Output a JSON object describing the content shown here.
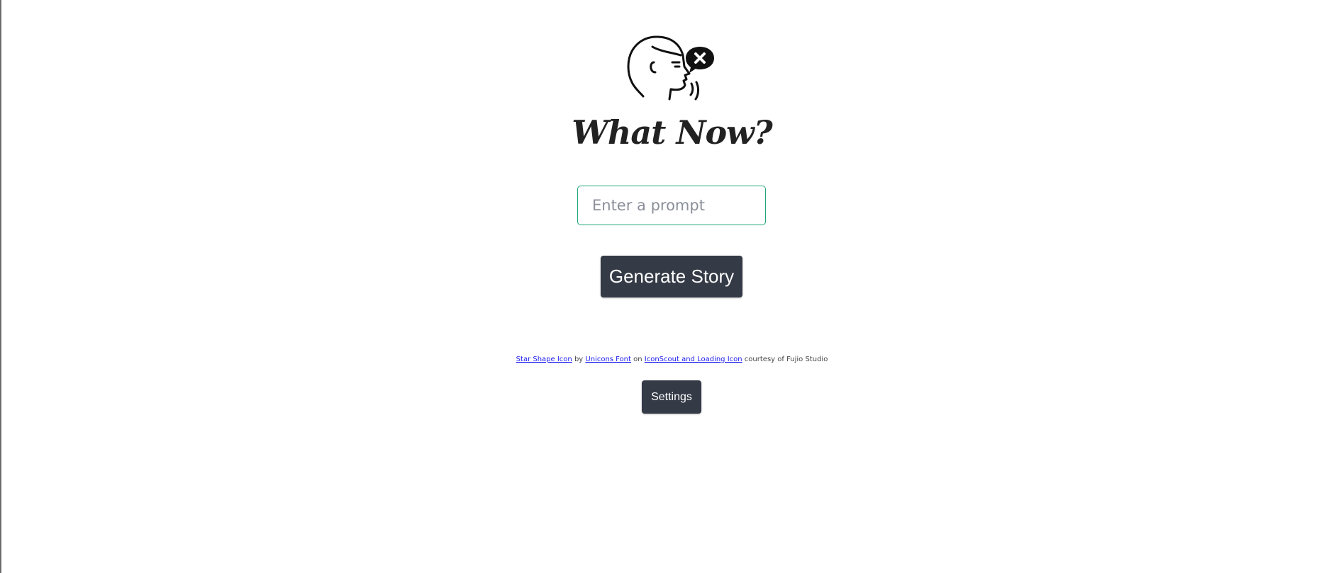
{
  "app": {
    "title": "What Now?"
  },
  "logo": {
    "icon": "person-speaking-icon",
    "bubble_icon": "close-icon"
  },
  "prompt": {
    "placeholder": "Enter a prompt",
    "value": ""
  },
  "actions": {
    "generate_label": "Generate Story",
    "settings_label": "Settings"
  },
  "attribution": {
    "link1": "Star Shape Icon",
    "text1": " by ",
    "link2": "Unicons Font",
    "text2": " on ",
    "link3": "IconScout and Loading Icon",
    "text3": " courtesy of Fujio Studio"
  },
  "colors": {
    "button_bg": "#343a46",
    "input_border": "#20a67a",
    "link": "#1a1aee"
  }
}
